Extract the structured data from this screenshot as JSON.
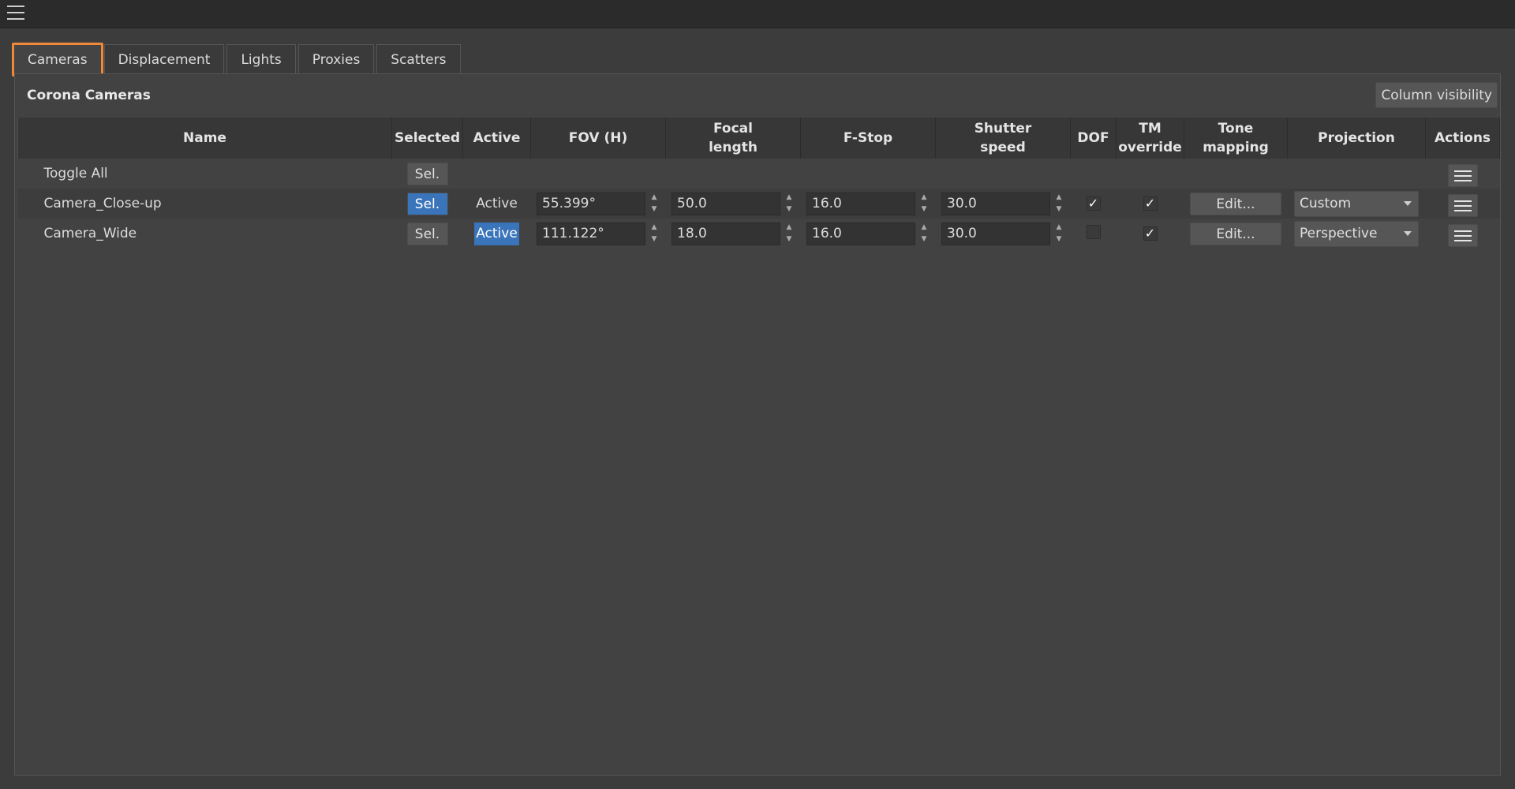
{
  "tabs": [
    {
      "label": "Cameras",
      "active": true
    },
    {
      "label": "Displacement",
      "active": false
    },
    {
      "label": "Lights",
      "active": false
    },
    {
      "label": "Proxies",
      "active": false
    },
    {
      "label": "Scatters",
      "active": false
    }
  ],
  "panel": {
    "title": "Corona Cameras",
    "column_visibility_label": "Column visibility"
  },
  "columns": {
    "name": "Name",
    "selected": "Selected",
    "active": "Active",
    "fov": "FOV (H)",
    "focal_1": "Focal",
    "focal_2": "length",
    "fstop": "F-Stop",
    "shutter_1": "Shutter",
    "shutter_2": "speed",
    "dof": "DOF",
    "tm_1": "TM",
    "tm_2": "override",
    "tone_mapping": "Tone mapping",
    "projection": "Projection",
    "actions": "Actions"
  },
  "toggle_all": {
    "name": "Toggle All",
    "sel_label": "Sel."
  },
  "rows": [
    {
      "name": "Camera_Close-up",
      "sel_label": "Sel.",
      "selected": true,
      "active_label": "Active",
      "active": false,
      "fov": "55.399°",
      "focal_length": "50.0",
      "fstop": "16.0",
      "shutter": "30.0",
      "dof": true,
      "tm_override": true,
      "edit_label": "Edit...",
      "projection": "Custom"
    },
    {
      "name": "Camera_Wide",
      "sel_label": "Sel.",
      "selected": false,
      "active_label": "Active",
      "active": true,
      "fov": "111.122°",
      "focal_length": "18.0",
      "fstop": "16.0",
      "shutter": "30.0",
      "dof": false,
      "tm_override": true,
      "edit_label": "Edit...",
      "projection": "Perspective"
    }
  ],
  "colors": {
    "accent_blue": "#3a74ba",
    "tab_highlight": "#f0883a"
  }
}
